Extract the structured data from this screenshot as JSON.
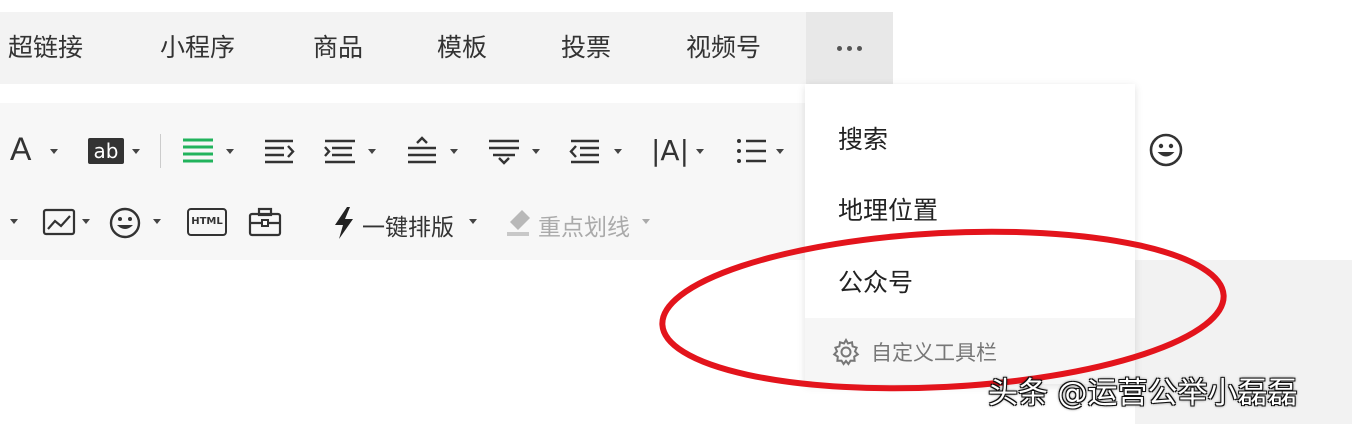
{
  "topbar": {
    "items": [
      "超链接",
      "小程序",
      "商品",
      "模板",
      "投票",
      "视频号"
    ]
  },
  "toolbar": {
    "font_letter": "A",
    "highlight_text": "ab",
    "html_text": "HTML",
    "align_text": "|A|",
    "one_click_layout": "一键排版",
    "highlight_line": "重点划线"
  },
  "dropdown": {
    "items": [
      "搜索",
      "地理位置",
      "公众号"
    ],
    "footer": "自定义工具栏"
  },
  "watermark": "头条 @运营公举小磊磊",
  "colors": {
    "accent_green": "#21b35c",
    "annotation_red": "#e3141c"
  }
}
